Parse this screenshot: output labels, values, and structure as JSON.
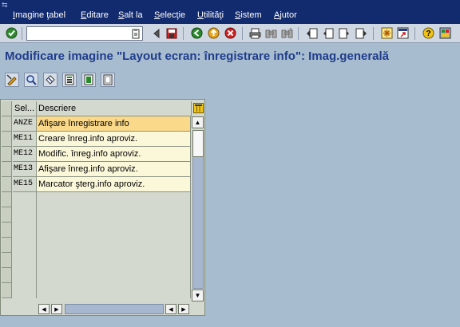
{
  "menubar": {
    "items": [
      {
        "label": "Imagine ţabel",
        "accel_index": 0
      },
      {
        "label": "Editare",
        "accel_index": 0
      },
      {
        "label": "Salt la",
        "accel_index": 0
      },
      {
        "label": "Selecţie",
        "accel_index": 0
      },
      {
        "label": "Utilităţi",
        "accel_index": 0
      },
      {
        "label": "Sistem",
        "accel_index": 0
      },
      {
        "label": "Ajutor",
        "accel_index": 0
      }
    ]
  },
  "toolbar": {
    "command_field_value": "",
    "icons": [
      "enter-check-icon",
      "command-field-clip-icon",
      "back-triangle-icon",
      "save-icon",
      "back-icon",
      "exit-icon",
      "cancel-icon",
      "print-icon",
      "find-icon",
      "find-next-icon",
      "first-page-icon",
      "previous-page-icon",
      "next-page-icon",
      "last-page-icon",
      "new-session-icon",
      "shortcut-icon",
      "help-icon",
      "layout-icon"
    ]
  },
  "title": "Modificare imagine \"Layout ecran: înregistrare info\": Imag.generală",
  "app_toolbar": {
    "icons": [
      "change-display-icon",
      "details-icon",
      "refresh-icon",
      "select-block-icon",
      "select-all-icon",
      "deselect-icon"
    ]
  },
  "table": {
    "columns": [
      {
        "label": "Sel..."
      },
      {
        "label": "Descriere"
      }
    ],
    "rows": [
      {
        "key": "ANZE",
        "description": "Afişare înregistrare info",
        "selected": true
      },
      {
        "key": "ME11",
        "description": "Creare înreg.info aproviz.",
        "selected": false
      },
      {
        "key": "ME12",
        "description": "Modific. înreg.info aproviz.",
        "selected": false
      },
      {
        "key": "ME13",
        "description": "Afişare înreg.info aproviz.",
        "selected": false
      },
      {
        "key": "ME15",
        "description": "Marcator şterg.info aproviz.",
        "selected": false
      }
    ],
    "empty_row_count": 7
  },
  "colors": {
    "menubar_bg": "#122a6e",
    "title_text": "#1f3d8a",
    "page_bg": "#a8bcd0",
    "selected_cell": "#fbd98a",
    "data_cell": "#fbf8da"
  }
}
